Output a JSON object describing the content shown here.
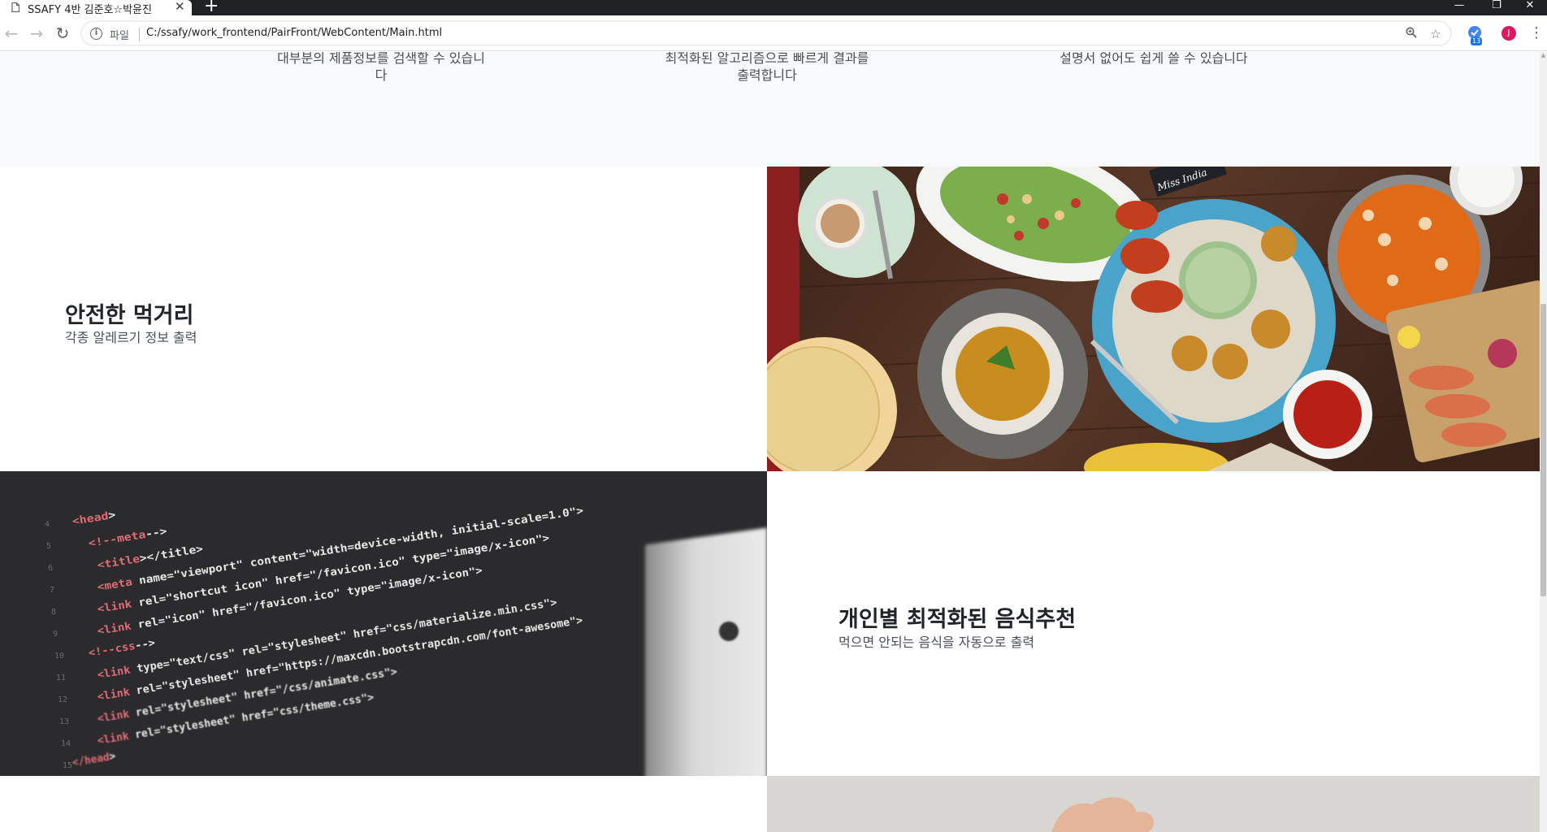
{
  "browser": {
    "tab_title": "SSAFY 4반 김준호☆박윤진",
    "tab_close": "✕",
    "new_tab": "+",
    "url_scheme": "파일",
    "url": "C:/ssafy/work_frontend/PairFront/WebContent/Main.html",
    "extension_badge": "13",
    "profile_initial": "J",
    "window_controls": [
      "—",
      "❐",
      "✕"
    ]
  },
  "features": [
    {
      "text": "대부분의 제품정보를 검색할 수 있습니다"
    },
    {
      "text": "최적화된 알고리즘으로 빠르게 결과를 출력합니다"
    },
    {
      "text": "설명서 없어도 쉽게 쓸 수 있습니다"
    }
  ],
  "showcases": [
    {
      "title": "안전한 먹거리",
      "description": "각종 알레르기 정보 출력",
      "image": "indian-food-spread-image"
    },
    {
      "title": "개인별 최적화된 음식추천",
      "description": "먹으면 안되는 음식을 자동으로 출력",
      "image": "code-editor-image"
    }
  ],
  "code_lines": [
    "<head>",
    "<!--meta-->",
    "<title></title>",
    "<meta name=\"viewport\" content=\"width=device-width, initial-scale=1.0\">",
    "<link rel=\"shortcut icon\" href=\"/favicon.ico\" type=\"image/x-icon\">",
    "<link rel=\"icon\" href=\"/favicon.ico\" type=\"image/x-icon\">",
    "<!--css-->",
    "<link type=\"text/css\" rel=\"stylesheet\" href=\"css/materialize.min.css\">",
    "<link rel=\"stylesheet\" href=\"https://maxcdn.bootstrapcdn.com/font-awesome\">",
    "<link rel=\"stylesheet\" href=\"/css/animate.css\">",
    "<link rel=\"stylesheet\" href=\"css/theme.css\">",
    "</head>"
  ],
  "code_line_numbers": [
    "4",
    "5",
    "6",
    "7",
    "8",
    "9",
    "10",
    "11",
    "12",
    "13",
    "14",
    "15"
  ],
  "food_label": "Miss India",
  "colors": {
    "chrome_dark": "#202124",
    "page_bg": "#f8f9fa",
    "heading": "#212529",
    "body_text": "#495057"
  }
}
